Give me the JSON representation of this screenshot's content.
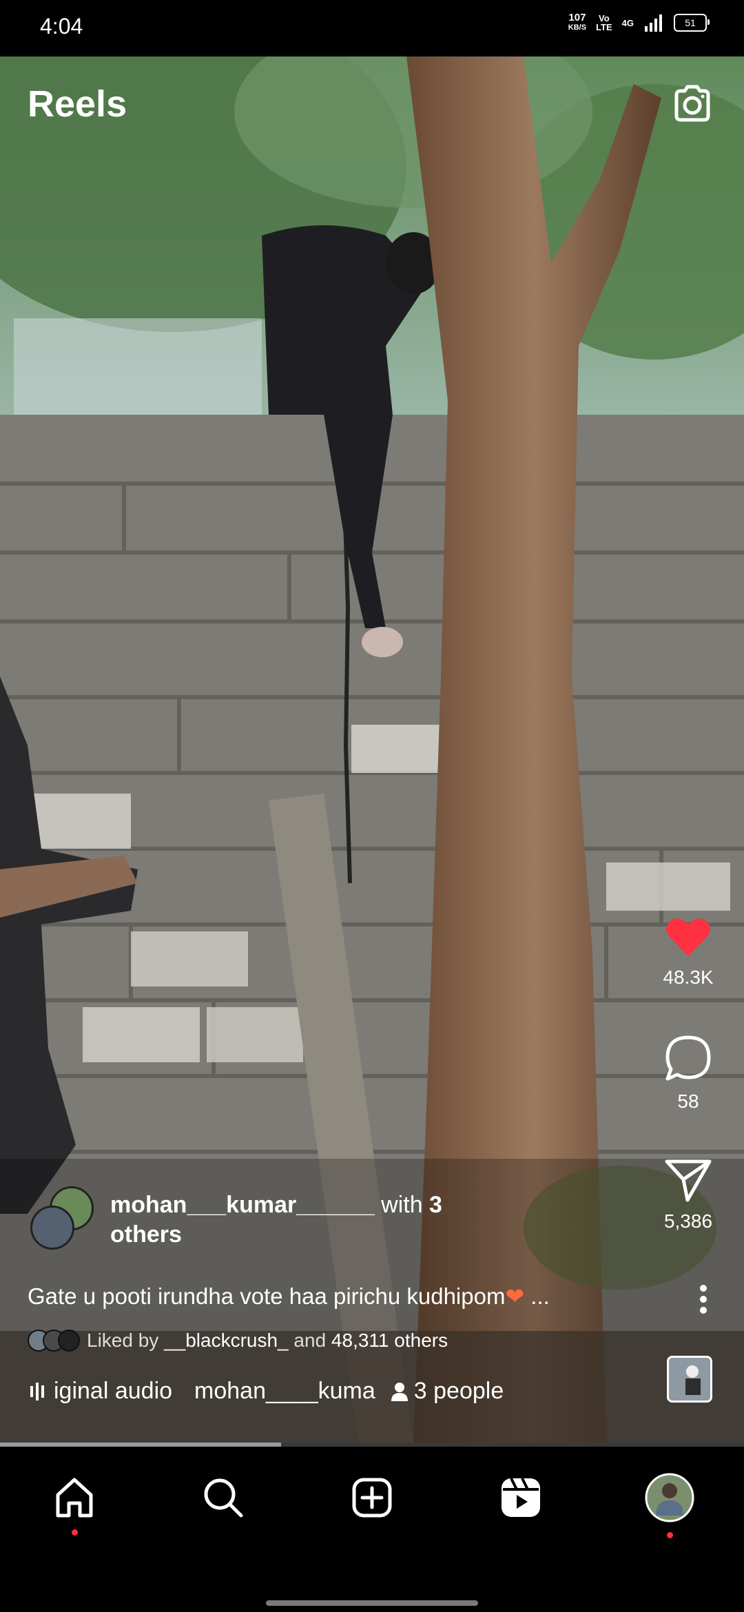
{
  "status_bar": {
    "time": "4:04",
    "speed_value": "107",
    "speed_unit": "KB/S",
    "volte_top": "Vo",
    "volte_bottom": "LTE",
    "network": "4G",
    "battery": "51"
  },
  "header": {
    "title": "Reels",
    "camera_icon": "camera-icon"
  },
  "actions": {
    "like_count": "48.3K",
    "comment_count": "58",
    "share_count": "5,386",
    "like_color": "#ff3040"
  },
  "post": {
    "username": "mohan___kumar______",
    "with_text": " with ",
    "collab_count": "3",
    "others_label": "others",
    "caption": "Gate u pooti irundha vote haa pirichu kudhipom",
    "caption_more": " ...",
    "liked_by_prefix": "Liked by ",
    "liked_by_user": "__blackcrush_",
    "liked_by_and": " and ",
    "liked_by_count": "48,311 others",
    "audio_label": "iginal audio",
    "audio_user": "mohan____kuma",
    "people_tag": "3 people"
  },
  "progress": {
    "value": 0.378
  },
  "nav": {
    "items": [
      "home-icon",
      "search-icon",
      "create-icon",
      "reels-icon",
      "profile-avatar"
    ]
  }
}
